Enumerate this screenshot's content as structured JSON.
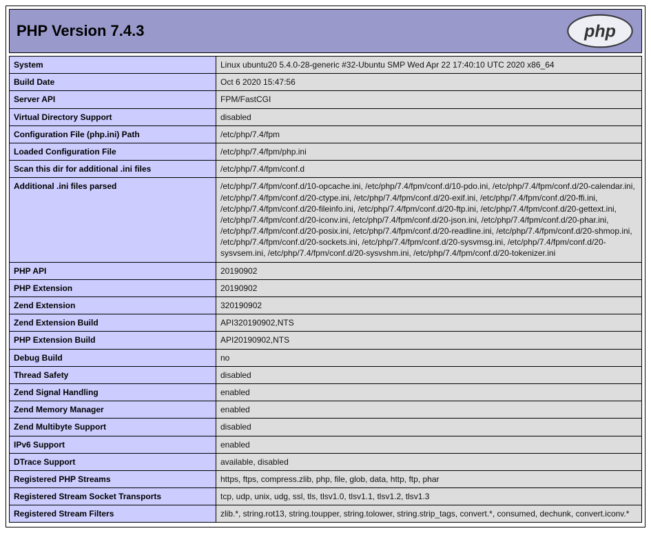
{
  "header": {
    "title": "PHP Version 7.4.3",
    "logo_text": "php"
  },
  "rows": [
    {
      "label": "System",
      "value": "Linux ubuntu20 5.4.0-28-generic #32-Ubuntu SMP Wed Apr 22 17:40:10 UTC 2020 x86_64"
    },
    {
      "label": "Build Date",
      "value": "Oct 6 2020 15:47:56"
    },
    {
      "label": "Server API",
      "value": "FPM/FastCGI"
    },
    {
      "label": "Virtual Directory Support",
      "value": "disabled"
    },
    {
      "label": "Configuration File (php.ini) Path",
      "value": "/etc/php/7.4/fpm"
    },
    {
      "label": "Loaded Configuration File",
      "value": "/etc/php/7.4/fpm/php.ini"
    },
    {
      "label": "Scan this dir for additional .ini files",
      "value": "/etc/php/7.4/fpm/conf.d"
    },
    {
      "label": "Additional .ini files parsed",
      "value": "/etc/php/7.4/fpm/conf.d/10-opcache.ini, /etc/php/7.4/fpm/conf.d/10-pdo.ini, /etc/php/7.4/fpm/conf.d/20-calendar.ini, /etc/php/7.4/fpm/conf.d/20-ctype.ini, /etc/php/7.4/fpm/conf.d/20-exif.ini, /etc/php/7.4/fpm/conf.d/20-ffi.ini, /etc/php/7.4/fpm/conf.d/20-fileinfo.ini, /etc/php/7.4/fpm/conf.d/20-ftp.ini, /etc/php/7.4/fpm/conf.d/20-gettext.ini, /etc/php/7.4/fpm/conf.d/20-iconv.ini, /etc/php/7.4/fpm/conf.d/20-json.ini, /etc/php/7.4/fpm/conf.d/20-phar.ini, /etc/php/7.4/fpm/conf.d/20-posix.ini, /etc/php/7.4/fpm/conf.d/20-readline.ini, /etc/php/7.4/fpm/conf.d/20-shmop.ini, /etc/php/7.4/fpm/conf.d/20-sockets.ini, /etc/php/7.4/fpm/conf.d/20-sysvmsg.ini, /etc/php/7.4/fpm/conf.d/20-sysvsem.ini, /etc/php/7.4/fpm/conf.d/20-sysvshm.ini, /etc/php/7.4/fpm/conf.d/20-tokenizer.ini"
    },
    {
      "label": "PHP API",
      "value": "20190902"
    },
    {
      "label": "PHP Extension",
      "value": "20190902"
    },
    {
      "label": "Zend Extension",
      "value": "320190902"
    },
    {
      "label": "Zend Extension Build",
      "value": "API320190902,NTS"
    },
    {
      "label": "PHP Extension Build",
      "value": "API20190902,NTS"
    },
    {
      "label": "Debug Build",
      "value": "no"
    },
    {
      "label": "Thread Safety",
      "value": "disabled"
    },
    {
      "label": "Zend Signal Handling",
      "value": "enabled"
    },
    {
      "label": "Zend Memory Manager",
      "value": "enabled"
    },
    {
      "label": "Zend Multibyte Support",
      "value": "disabled"
    },
    {
      "label": "IPv6 Support",
      "value": "enabled"
    },
    {
      "label": "DTrace Support",
      "value": "available, disabled"
    },
    {
      "label": "Registered PHP Streams",
      "value": "https, ftps, compress.zlib, php, file, glob, data, http, ftp, phar"
    },
    {
      "label": "Registered Stream Socket Transports",
      "value": "tcp, udp, unix, udg, ssl, tls, tlsv1.0, tlsv1.1, tlsv1.2, tlsv1.3"
    },
    {
      "label": "Registered Stream Filters",
      "value": "zlib.*, string.rot13, string.toupper, string.tolower, string.strip_tags, convert.*, consumed, dechunk, convert.iconv.*"
    }
  ]
}
